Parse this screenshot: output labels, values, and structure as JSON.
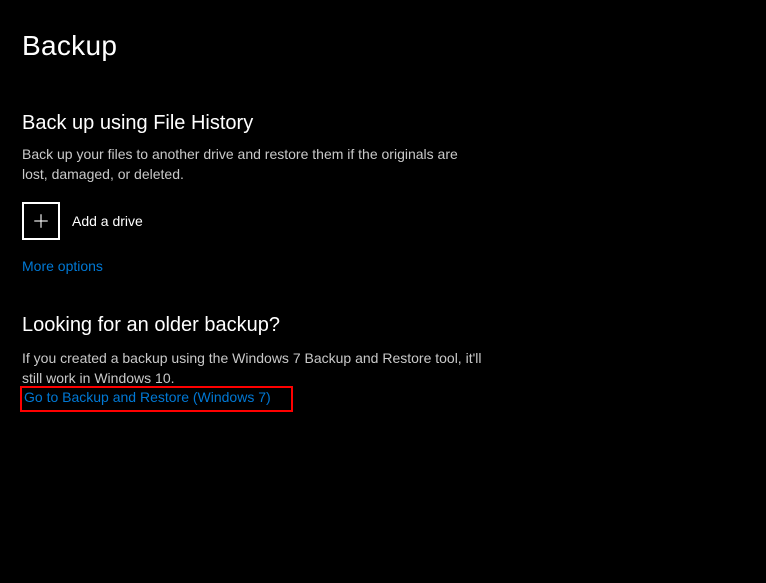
{
  "page": {
    "title": "Backup"
  },
  "file_history": {
    "heading": "Back up using File History",
    "description": "Back up your files to another drive and restore them if the originals are lost, damaged, or deleted.",
    "add_drive_label": "Add a drive",
    "more_options_label": "More options"
  },
  "older_backup": {
    "heading": "Looking for an older backup?",
    "description": "If you created a backup using the Windows 7 Backup and Restore tool, it'll still work in Windows 10.",
    "link_label": "Go to Backup and Restore (Windows 7)"
  },
  "colors": {
    "link": "#0078d4",
    "highlight_border": "#ff0000"
  }
}
